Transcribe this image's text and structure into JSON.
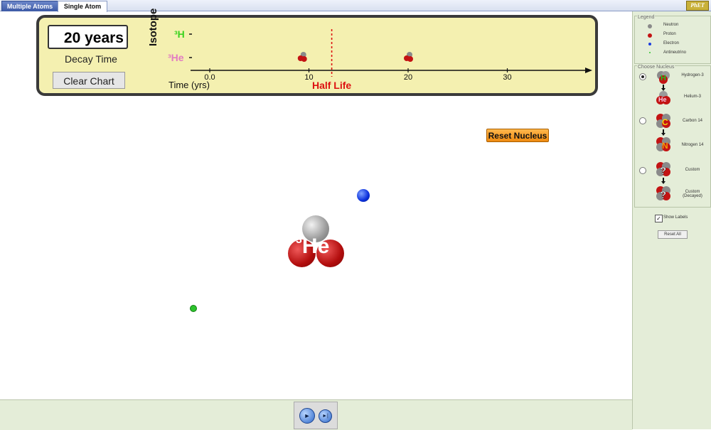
{
  "tabs": [
    {
      "label": "Multiple Atoms",
      "active": false
    },
    {
      "label": "Single Atom",
      "active": true
    }
  ],
  "logo": "PhET",
  "chart": {
    "decay_time_value": "20 years",
    "decay_time_label": "Decay Time",
    "clear_label": "Clear Chart",
    "y_axis_label": "Isotope",
    "isotope_top": "³H",
    "isotope_bottom": "³He",
    "x_axis_label": "Time (yrs)",
    "half_life_label": "Half Life",
    "x_ticks": [
      "0.0",
      "10",
      "20",
      "30"
    ],
    "half_life_years": 12.3,
    "decay_events_years": [
      9.3,
      20
    ]
  },
  "reset_nucleus_label": "Reset Nucleus",
  "atom": {
    "label_sup": "3",
    "label_symbol": "He"
  },
  "legend": {
    "title": "Legend",
    "items": [
      {
        "label": "Neutron",
        "color": "#8a8a8a"
      },
      {
        "label": "Proton",
        "color": "#c31313"
      },
      {
        "label": "Electron",
        "color": "#1a3de0"
      },
      {
        "label": "Antineutrino",
        "color": "#2cc32c"
      }
    ]
  },
  "choose_nucleus": {
    "title": "Choose Nucleus",
    "options": [
      {
        "from": "Hydrogen-3",
        "to": "Helium-3",
        "from_symbol": "H",
        "to_symbol": "He",
        "selected": true
      },
      {
        "from": "Carbon 14",
        "to": "Nitrogen 14",
        "from_symbol": "C",
        "to_symbol": "N",
        "selected": false
      },
      {
        "from": "Custom",
        "to": "Custom (Decayed)",
        "from_symbol": "?",
        "to_symbol": "?",
        "selected": false
      }
    ]
  },
  "show_labels": {
    "label": "Show Labels",
    "checked": true
  },
  "reset_all_label": "Reset All"
}
